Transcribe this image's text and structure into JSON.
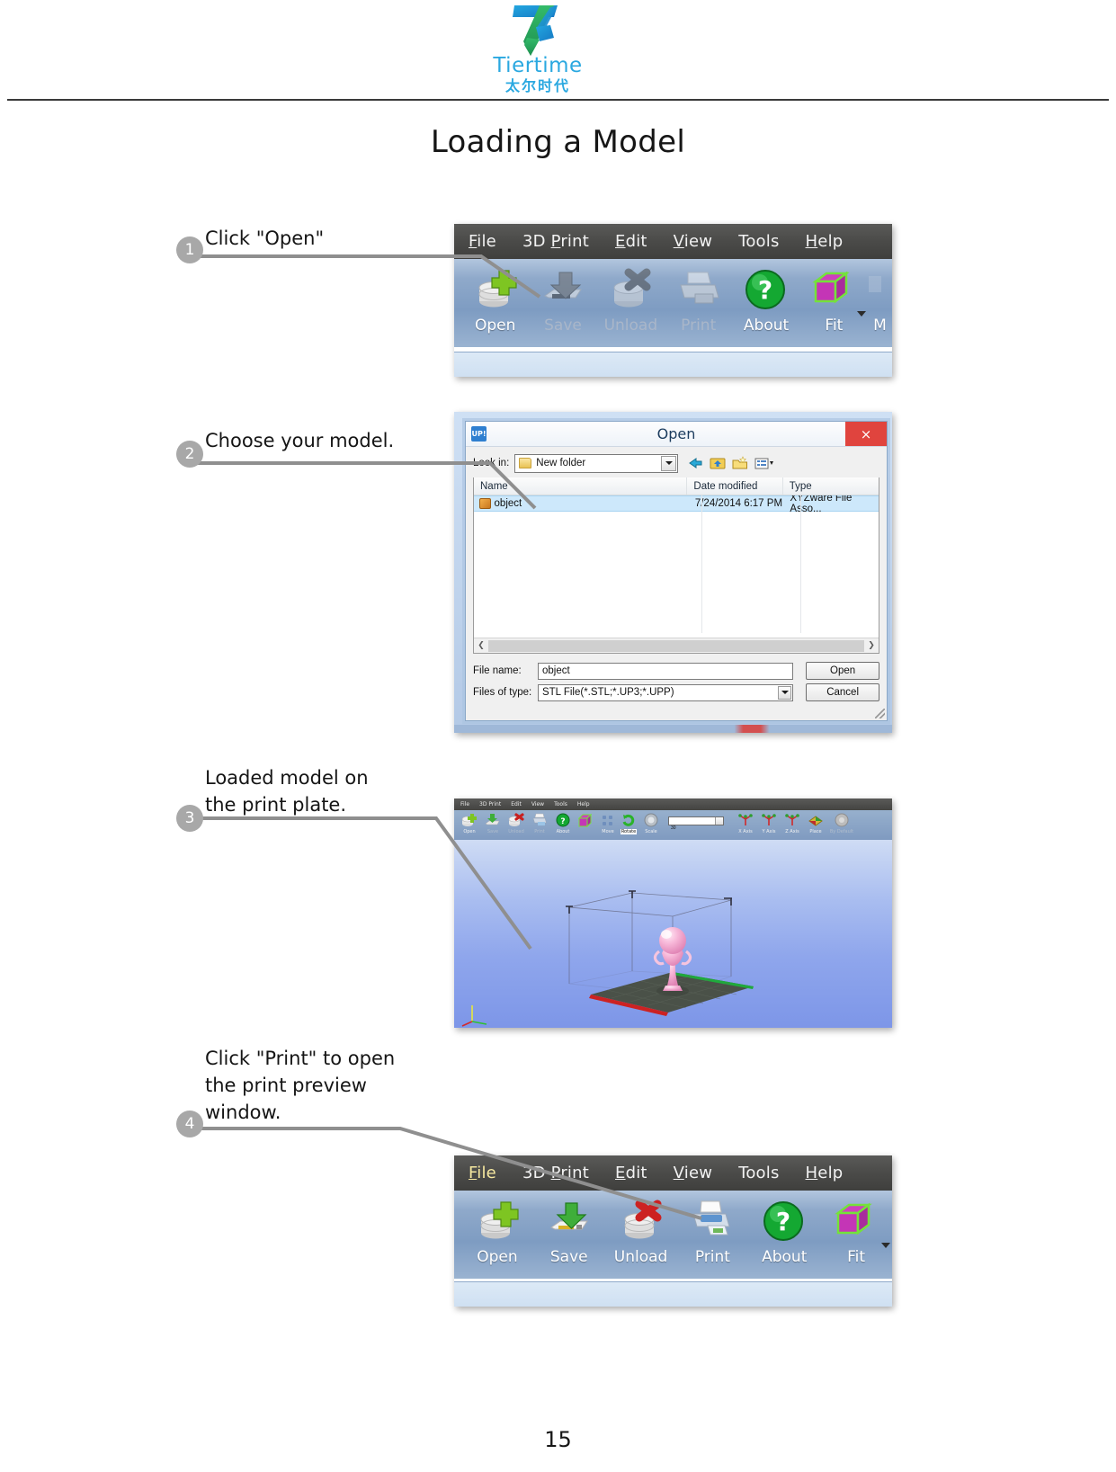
{
  "brand": {
    "name": "Tiertime",
    "name_cn": "太尔时代",
    "logo_colors": {
      "blue": "#1f8fd6",
      "green": "#22a95a",
      "text": "#2aa8e0"
    }
  },
  "page": {
    "title": "Loading a Model",
    "number": "15"
  },
  "steps": [
    {
      "number": "1",
      "text": "Click \"Open\""
    },
    {
      "number": "2",
      "text": "Choose your model."
    },
    {
      "number": "3",
      "text": "Loaded model on\nthe print plate."
    },
    {
      "number": "4",
      "text": "Click \"Print\" to open\nthe print preview\nwindow."
    }
  ],
  "toolbar_top": {
    "menu": [
      {
        "label": "File",
        "mnemonic": "F"
      },
      {
        "label": "3D Print",
        "mnemonic": "P"
      },
      {
        "label": "Edit",
        "mnemonic": "E"
      },
      {
        "label": "View",
        "mnemonic": "V"
      },
      {
        "label": "Tools",
        "mnemonic": ""
      },
      {
        "label": "Help",
        "mnemonic": "H"
      }
    ],
    "buttons": [
      {
        "label": "Open",
        "icon": "open-disc-plus-icon",
        "enabled": true
      },
      {
        "label": "Save",
        "icon": "save-disk-arrow-icon",
        "enabled": false
      },
      {
        "label": "Unload",
        "icon": "unload-disc-x-icon",
        "enabled": false
      },
      {
        "label": "Print",
        "icon": "printer-icon",
        "enabled": false
      },
      {
        "label": "About",
        "icon": "green-question-icon",
        "enabled": true
      },
      {
        "label": "Fit",
        "icon": "fit-cube-icon",
        "enabled": true
      },
      {
        "label": "M",
        "icon": "move-icon",
        "enabled": true
      }
    ]
  },
  "toolbar_bottom": {
    "menu": [
      {
        "label": "File",
        "mnemonic": "F",
        "highlighted": true
      },
      {
        "label": "3D Print",
        "mnemonic": "P"
      },
      {
        "label": "Edit",
        "mnemonic": "E"
      },
      {
        "label": "View",
        "mnemonic": "V"
      },
      {
        "label": "Tools",
        "mnemonic": ""
      },
      {
        "label": "Help",
        "mnemonic": "H"
      }
    ],
    "buttons": [
      {
        "label": "Open",
        "icon": "open-disc-plus-icon",
        "enabled": true
      },
      {
        "label": "Save",
        "icon": "save-disk-arrow-icon",
        "enabled": true
      },
      {
        "label": "Unload",
        "icon": "unload-disc-x-icon",
        "enabled": true
      },
      {
        "label": "Print",
        "icon": "printer-icon",
        "enabled": true
      },
      {
        "label": "About",
        "icon": "green-question-icon",
        "enabled": true
      },
      {
        "label": "Fit",
        "icon": "fit-cube-icon",
        "enabled": true
      }
    ]
  },
  "open_dialog": {
    "app_badge": "UP!",
    "title": "Open",
    "close_label": "×",
    "look_in_label": "Look in:",
    "look_in_value": "New folder",
    "nav_icons": [
      "back-arrow-icon",
      "up-folder-icon",
      "new-folder-icon",
      "views-icon"
    ],
    "columns": [
      "Name",
      "Date modified",
      "Type"
    ],
    "rows": [
      {
        "name": "object",
        "date_modified": "7/24/2014 6:17 PM",
        "type": "XYZware File Asso..."
      }
    ],
    "file_name_label": "File name:",
    "file_name_value": "object",
    "files_of_type_label": "Files of type:",
    "files_of_type_value": "STL File(*.STL;*.UP3;*.UPP)",
    "buttons": {
      "open": "Open",
      "cancel": "Cancel"
    }
  },
  "viewport_3d": {
    "menu": [
      "File",
      "3D Print",
      "Edit",
      "View",
      "Tools",
      "Help"
    ],
    "buttons": [
      {
        "label": "Open",
        "enabled": true
      },
      {
        "label": "Save",
        "enabled": false
      },
      {
        "label": "Unload",
        "enabled": false
      },
      {
        "label": "Print",
        "enabled": false
      },
      {
        "label": "About",
        "enabled": true
      },
      {
        "label": "Fit",
        "enabled": true
      },
      {
        "label": "Move",
        "enabled": true
      },
      {
        "label": "Rotate",
        "enabled": true,
        "selected": true
      },
      {
        "label": "Scale",
        "enabled": true
      }
    ],
    "value_combo": "30",
    "axis_buttons": [
      {
        "label": "X Axis"
      },
      {
        "label": "Y Axis"
      },
      {
        "label": "Z Axis"
      },
      {
        "label": "Place"
      },
      {
        "label": "By Default",
        "enabled": false
      }
    ],
    "model": {
      "name": "trophy-model",
      "color": "#f3a8cf"
    },
    "plate": {
      "front_edge_color": "#cc2222",
      "right_edge_color": "#1faa3c",
      "surface_color": "#4a5148"
    },
    "axis_gizmo": {
      "x_color": "#d42a2a",
      "y_color": "#2ec02e",
      "z_color": "#e8e83a"
    }
  }
}
